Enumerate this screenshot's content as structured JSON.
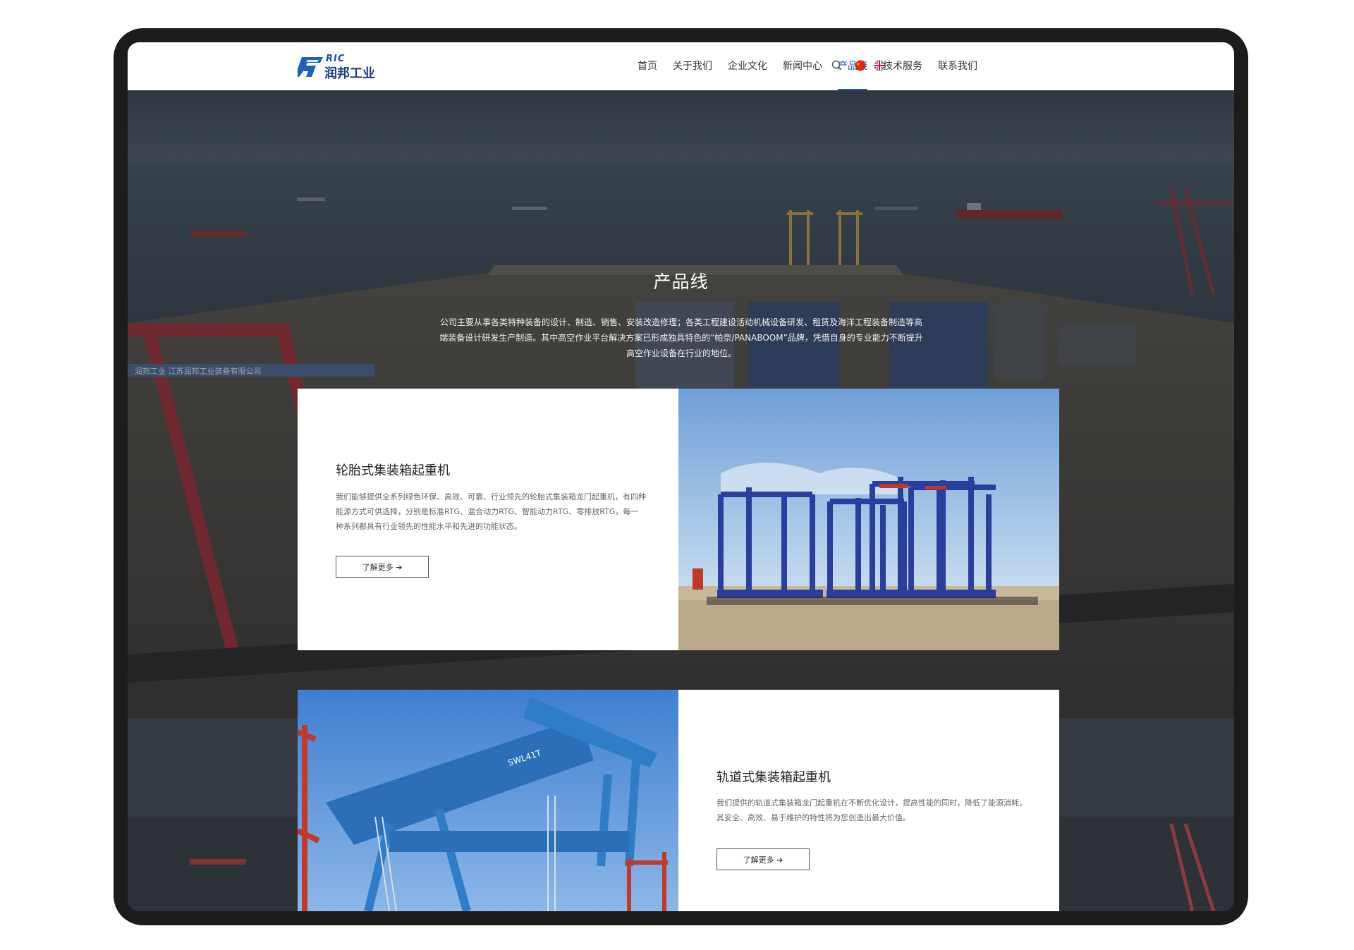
{
  "brand": {
    "logo_en": "RIC",
    "logo_cn": "润邦工业",
    "blue": "#1a5fb4"
  },
  "nav": {
    "items": [
      {
        "label": "首页",
        "active": false
      },
      {
        "label": "关于我们",
        "active": false
      },
      {
        "label": "企业文化",
        "active": false
      },
      {
        "label": "新闻中心",
        "active": false
      },
      {
        "label": "产品线",
        "active": true
      },
      {
        "label": "技术服务",
        "active": false
      },
      {
        "label": "联系我们",
        "active": false
      }
    ],
    "icons": [
      "search-icon",
      "china-flag-icon",
      "uk-flag-icon"
    ]
  },
  "hero": {
    "title": "产品线",
    "description": "公司主要从事各类特种装备的设计、制造、销售、安装改造修理；各类工程建设活动机械设备研发、租赁及海洋工程装备制造等高端装备设计研发生产制造。其中高空作业平台解决方案已形成独具特色的“帕奈/PANABOOM”品牌，凭借自身的专业能力不断提升高空作业设备在行业的地位。",
    "wall_sign": "润邦工业  江苏润邦工业装备有限公司"
  },
  "products": [
    {
      "title": "轮胎式集装箱起重机",
      "description": "我们能够提供全系列绿色环保、高效、可靠、行业领先的轮胎式集装箱龙门起重机，有四种能源方式可供选择，分别是标准RTG、混合动力RTG、智能动力RTG、零排放RTG，每一种系列都具有行业领先的性能水平和先进的功能状态。",
      "button": "了解更多 ➔"
    },
    {
      "title": "轨道式集装箱起重机",
      "description": "我们提供的轨道式集装箱龙门起重机在不断优化设计，提高性能的同时，降低了能源消耗，其安全、高效、易于维护的特性将为您创造出最大价值。",
      "button": "了解更多 ➔",
      "crane_label": "SWL41T"
    }
  ]
}
